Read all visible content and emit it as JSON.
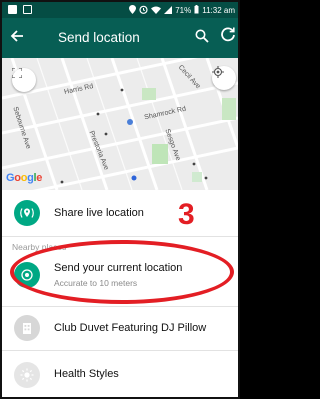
{
  "statusbar": {
    "time": "11:32 am",
    "battery": "71%",
    "icons": [
      "notification-icon",
      "image-icon",
      "location-pin-icon",
      "alarm-icon",
      "wifi-icon",
      "signal-icon",
      "battery-icon"
    ]
  },
  "appbar": {
    "title": "Send location",
    "back_icon": "arrow-left-icon",
    "search_icon": "search-icon",
    "refresh_icon": "refresh-icon",
    "background": "#075e54"
  },
  "map": {
    "streets": [
      "Harris Rd",
      "Sebourne Ave",
      "Prestoria Ave",
      "Shamrock Rd",
      "Cecil Ave",
      "Sesgo Ave"
    ],
    "google_logo": "Google",
    "controls": [
      "fullscreen-icon",
      "my-location-icon"
    ]
  },
  "live_location": {
    "label": "Share live location",
    "icon": "live-location-icon",
    "color": "#00a884"
  },
  "nearby": {
    "header": "Nearby places",
    "items": [
      {
        "label": "Send your current location",
        "sub": "Accurate to 10 meters",
        "icon": "current-location-icon",
        "color": "#00a884"
      },
      {
        "label": "Club Duvet Featuring DJ Pillow",
        "icon": "building-icon",
        "color": "#d7d7d7"
      },
      {
        "label": "Health Styles",
        "icon": "sun-icon",
        "color": "#e5e5e5"
      }
    ]
  },
  "annotation": {
    "step_number": "3",
    "color": "#e31e24"
  }
}
